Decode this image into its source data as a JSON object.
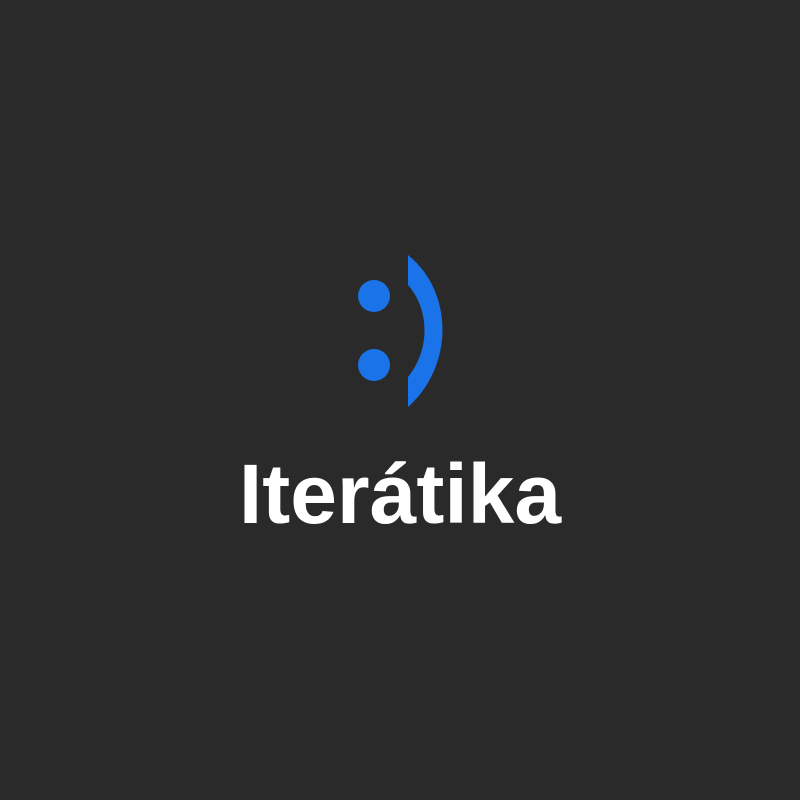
{
  "splash": {
    "app_name": "Iterátika",
    "logo_icon": "smiley-face-icon",
    "accent_color": "#1a73e8",
    "background_color": "#2a2a2a",
    "text_color": "#ffffff"
  }
}
